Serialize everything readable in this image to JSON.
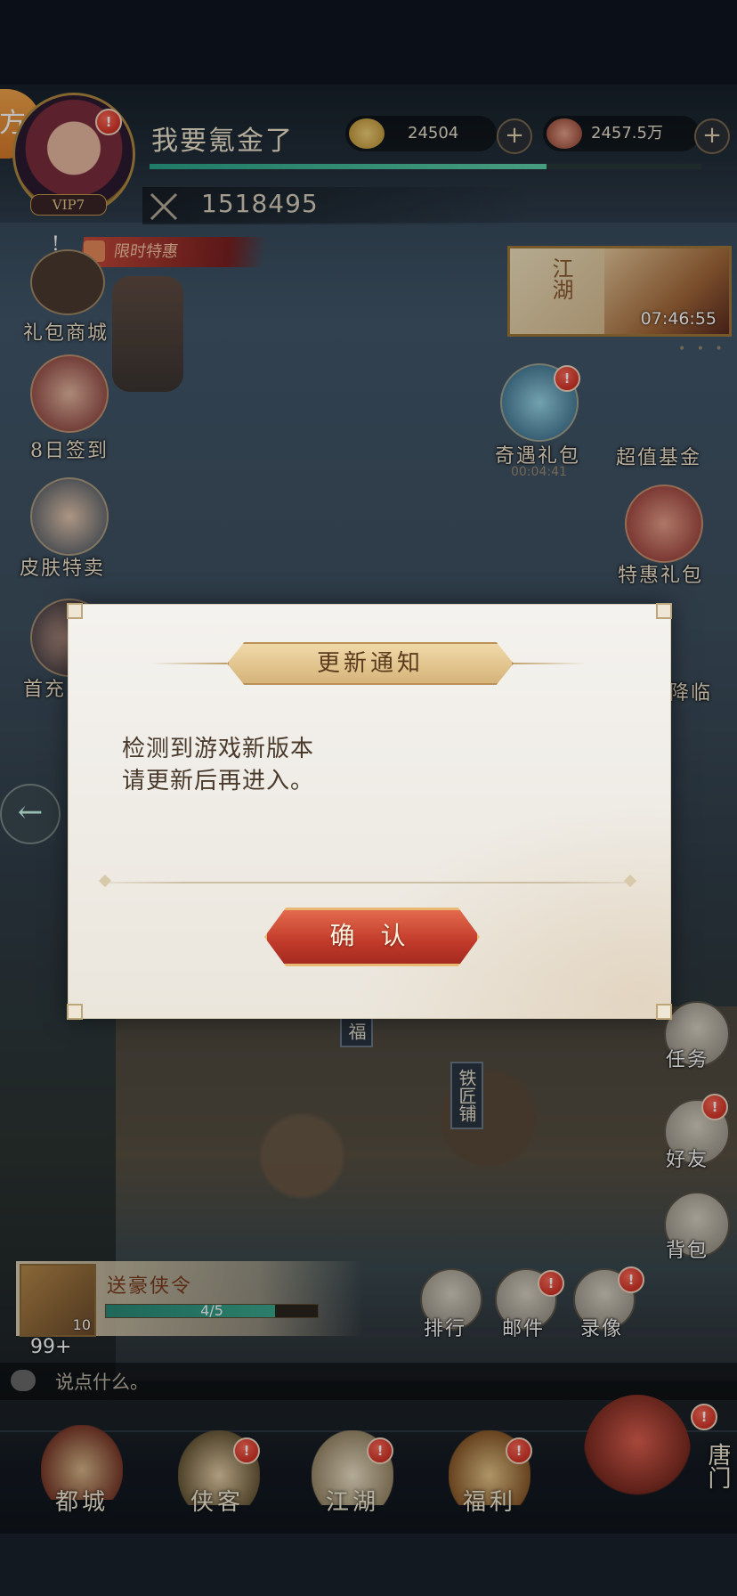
{
  "player": {
    "name": "我要氪金了",
    "vip": "VIP7",
    "side_badge": "方",
    "power": "1518495"
  },
  "resources": {
    "gold_ingot": "24504",
    "copper": "2457.5万"
  },
  "top_banner": {
    "text": "限时特惠",
    "exclaim": "!"
  },
  "event_card": {
    "title": "江湖",
    "timer": "07:46:55"
  },
  "left_menu": [
    {
      "label": "礼包商城"
    },
    {
      "label": "8日签到"
    },
    {
      "label": "皮肤特卖"
    },
    {
      "label": "首充"
    }
  ],
  "right_menu": [
    {
      "label": "奇遇礼包",
      "subtitle": "00:04:41"
    },
    {
      "label": "超值基金"
    },
    {
      "label": "特惠礼包"
    },
    {
      "label": "降临"
    }
  ],
  "map": {
    "sign_fu": "福",
    "sign_smith": "铁匠铺"
  },
  "side_actions": [
    {
      "label": "任务"
    },
    {
      "label": "好友"
    },
    {
      "label": "背包"
    }
  ],
  "quest": {
    "title": "送豪侠令",
    "level": "10",
    "progress": "4/5"
  },
  "chat": {
    "count": "99+",
    "placeholder": "说点什么。"
  },
  "func_buttons": [
    {
      "label": "排行"
    },
    {
      "label": "邮件"
    },
    {
      "label": "录像"
    }
  ],
  "bottom_nav": [
    {
      "label": "都城"
    },
    {
      "label": "侠客"
    },
    {
      "label": "江湖"
    },
    {
      "label": "福利"
    }
  ],
  "bottom_right_label": "唐门",
  "badge_text": "!",
  "dialog": {
    "title": "更新通知",
    "line1": "检测到游戏新版本",
    "line2": "请更新后再进入。",
    "confirm": "确 认"
  }
}
